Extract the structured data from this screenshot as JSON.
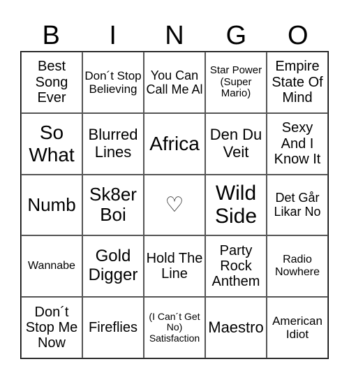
{
  "header": [
    "B",
    "I",
    "N",
    "G",
    "O"
  ],
  "cells": [
    "Best Song Ever",
    "Don´t Stop Believing",
    "You Can Call Me Al",
    "Star Power (Super Mario)",
    "Empire State Of Mind",
    "So What",
    "Blurred Lines",
    "Africa",
    "Den Du Veit",
    "Sexy And I Know It",
    "Numb",
    "Sk8er Boi",
    "♡",
    "Wild Side",
    "Det Går Likar No",
    "Wannabe",
    "Gold Digger",
    "Hold The Line",
    "Party Rock Anthem",
    "Radio Nowhere",
    "Don´t Stop Me Now",
    "Fireflies",
    "(I Can´t Get No) Satisfaction",
    "Maestro",
    "American Idiot"
  ],
  "free_space_icon": "heart-outline-icon"
}
